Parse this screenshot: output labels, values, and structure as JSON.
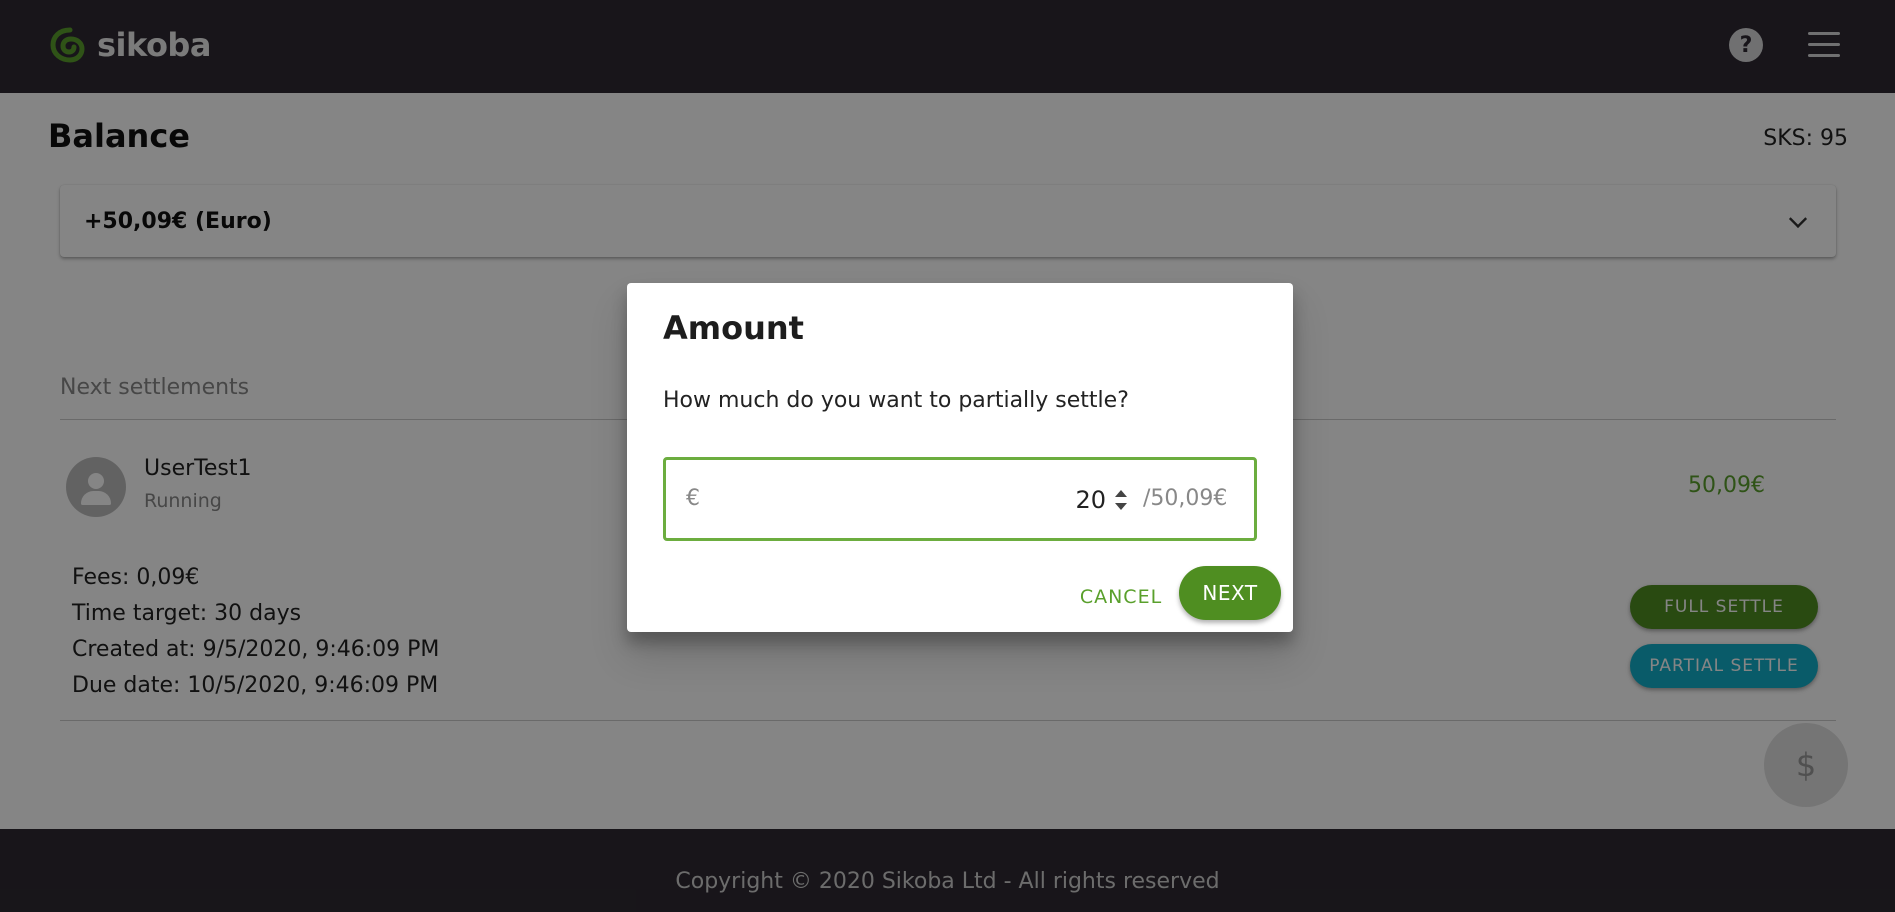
{
  "header": {
    "logo_text": "sikoba",
    "help_icon": "help-circle-icon",
    "menu_icon": "hamburger-menu-icon"
  },
  "page": {
    "title": "Balance",
    "sks_label": "SKS: 95"
  },
  "balance_panel": {
    "value": "+50,09€ (Euro)",
    "expand_icon": "chevron-down-icon"
  },
  "settlements": {
    "section_label": "Next settlements",
    "items": [
      {
        "user": "UserTest1",
        "status": "Running",
        "amount": "50,09€",
        "fees": "Fees: 0,09€",
        "time_target": "Time target: 30 days",
        "created_at": "Created at: 9/5/2020, 9:46:09 PM",
        "due_date": "Due date: 10/5/2020, 9:46:09 PM",
        "full_settle_label": "FULL SETTLE",
        "partial_settle_label": "PARTIAL SETTLE"
      }
    ]
  },
  "fab": {
    "symbol": "$",
    "icon": "dollar-icon"
  },
  "footer": {
    "copyright": "Copyright © 2020 Sikoba Ltd - All rights reserved"
  },
  "dialog": {
    "title": "Amount",
    "question": "How much do you want to partially settle?",
    "currency_prefix": "€",
    "input_value": "20",
    "max_suffix": "/50,09€",
    "cancel_label": "CANCEL",
    "next_label": "NEXT"
  },
  "colors": {
    "header_bg": "#2e2a32",
    "brand_green": "#4f8e21",
    "accent_green": "#5aa02c",
    "field_border_green": "#6cad3f",
    "partial_settle_cyan": "#13afc9"
  }
}
